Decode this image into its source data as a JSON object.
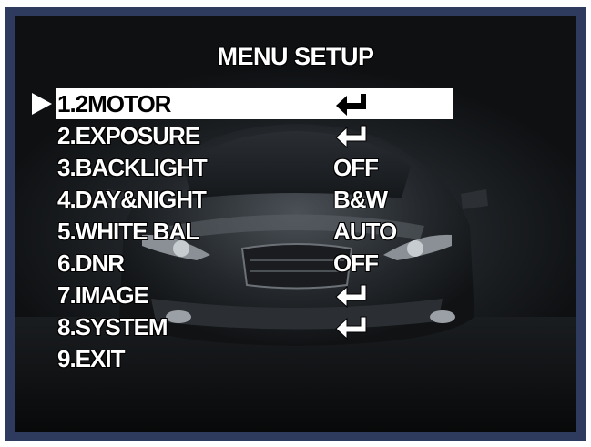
{
  "menu": {
    "title": "MENU SETUP",
    "selected_index": 0,
    "items": [
      {
        "label": "1.2MOTOR",
        "value": "",
        "icon": "enter-icon"
      },
      {
        "label": "2.EXPOSURE",
        "value": "",
        "icon": "enter-icon"
      },
      {
        "label": "3.BACKLIGHT",
        "value": "OFF",
        "icon": ""
      },
      {
        "label": "4.DAY&NIGHT",
        "value": "B&W",
        "icon": ""
      },
      {
        "label": "5.WHITE BAL",
        "value": "AUTO",
        "icon": ""
      },
      {
        "label": "6.DNR",
        "value": "OFF",
        "icon": ""
      },
      {
        "label": "7.IMAGE",
        "value": "",
        "icon": "enter-icon"
      },
      {
        "label": "8.SYSTEM",
        "value": "",
        "icon": "enter-icon"
      },
      {
        "label": "9.EXIT",
        "value": "",
        "icon": ""
      }
    ]
  },
  "colors": {
    "frame": "#2e3a5e",
    "text": "#ffffff",
    "highlight": "#ffffff",
    "highlight_text": "#000000"
  }
}
